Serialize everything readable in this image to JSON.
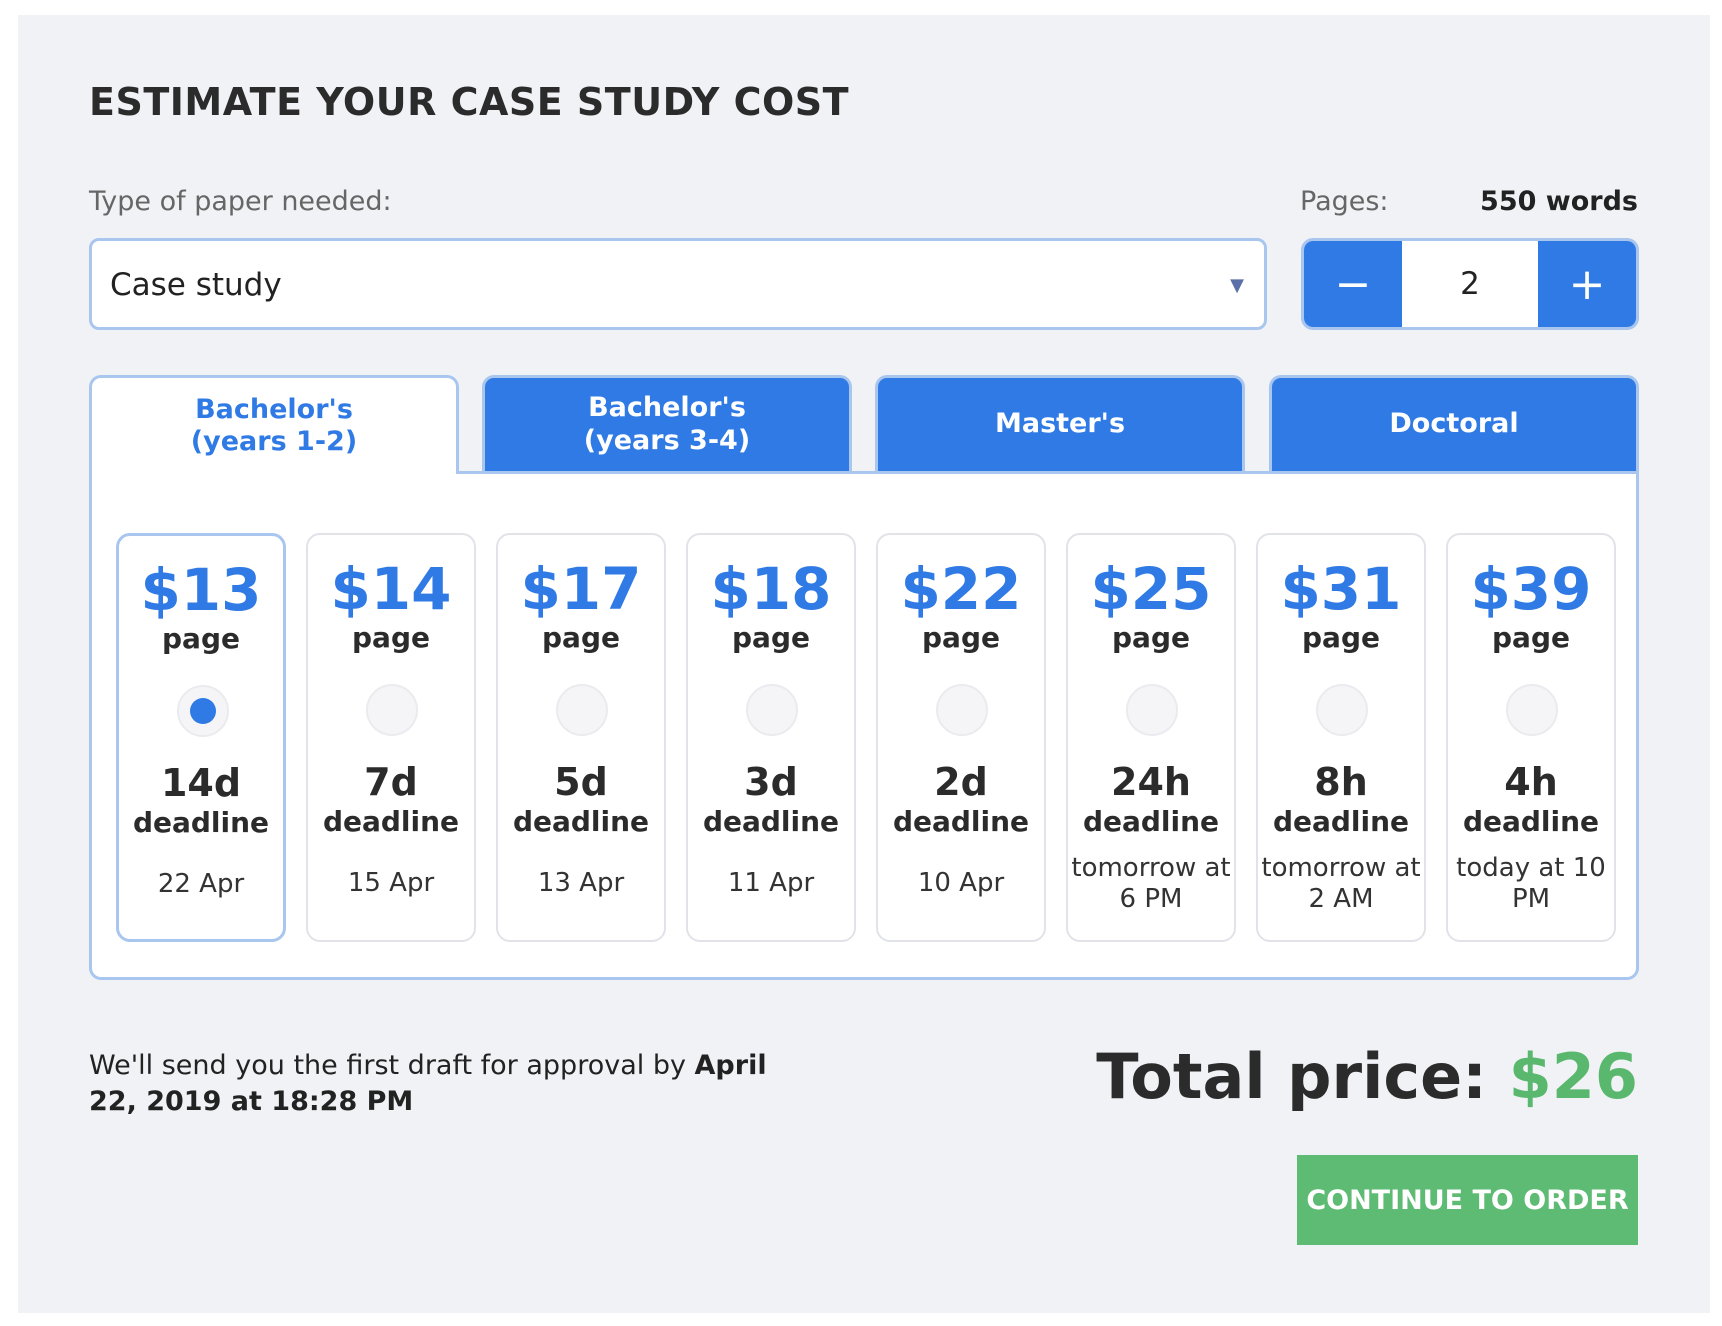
{
  "heading": "ESTIMATE YOUR CASE STUDY COST",
  "paper_type": {
    "label": "Type of paper needed:",
    "selected": "Case study",
    "caret_icon": "chevron-down-icon"
  },
  "pages": {
    "label": "Pages:",
    "words": "550 words",
    "count": "2",
    "minus_label": "−",
    "plus_label": "+"
  },
  "tabs": [
    {
      "label": "Bachelor's (years 1-2)",
      "active": true
    },
    {
      "label": "Bachelor's (years 3-4)",
      "active": false
    },
    {
      "label": "Master's",
      "active": false
    },
    {
      "label": "Doctoral",
      "active": false
    }
  ],
  "options": [
    {
      "price": "$13",
      "unit": "page",
      "duration": "14d",
      "deadline_label": "deadline",
      "date": "22 Apr",
      "selected": true
    },
    {
      "price": "$14",
      "unit": "page",
      "duration": "7d",
      "deadline_label": "deadline",
      "date": "15 Apr",
      "selected": false
    },
    {
      "price": "$17",
      "unit": "page",
      "duration": "5d",
      "deadline_label": "deadline",
      "date": "13 Apr",
      "selected": false
    },
    {
      "price": "$18",
      "unit": "page",
      "duration": "3d",
      "deadline_label": "deadline",
      "date": "11 Apr",
      "selected": false
    },
    {
      "price": "$22",
      "unit": "page",
      "duration": "2d",
      "deadline_label": "deadline",
      "date": "10 Apr",
      "selected": false
    },
    {
      "price": "$25",
      "unit": "page",
      "duration": "24h",
      "deadline_label": "deadline",
      "date": "tomorrow at 6 PM",
      "selected": false
    },
    {
      "price": "$31",
      "unit": "page",
      "duration": "8h",
      "deadline_label": "deadline",
      "date": "tomorrow at 2 AM",
      "selected": false
    },
    {
      "price": "$39",
      "unit": "page",
      "duration": "4h",
      "deadline_label": "deadline",
      "date": "today at 10 PM",
      "selected": false
    }
  ],
  "note": {
    "text": "We'll send you the first draft for approval by ",
    "date": "April 22, 2019 at 18:28 PM"
  },
  "total": {
    "label": "Total price:",
    "amount": "$26"
  },
  "cta": "CONTINUE TO ORDER",
  "colors": {
    "accent": "#2f7ae5",
    "success": "#5dbb73",
    "border": "#a9c6ef",
    "background": "#f1f2f6"
  }
}
